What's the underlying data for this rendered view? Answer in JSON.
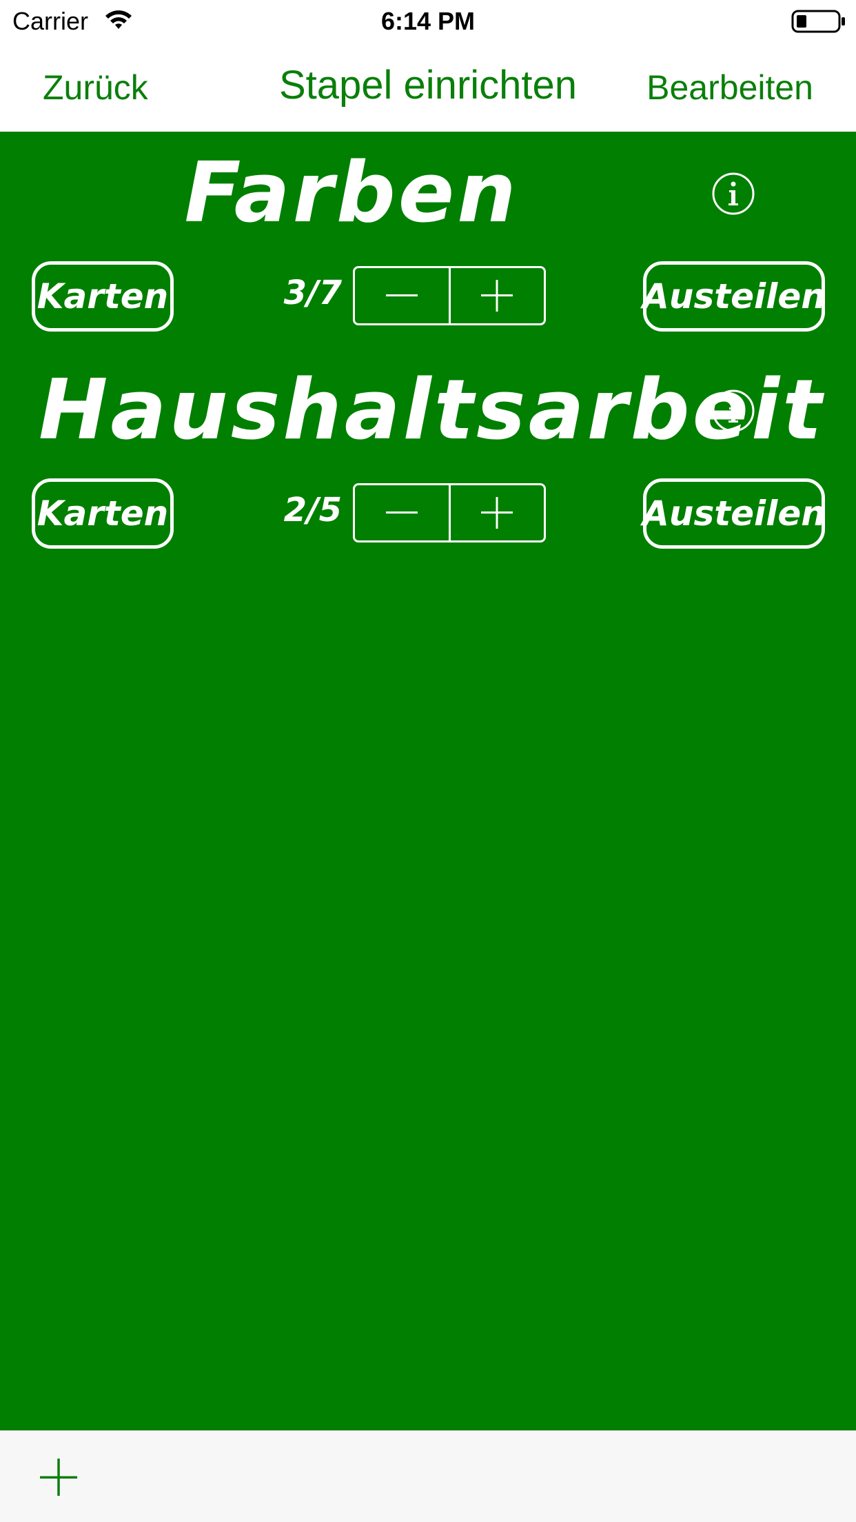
{
  "status_bar": {
    "carrier": "Carrier",
    "time": "6:14 PM",
    "wifi_icon": "wifi-icon",
    "battery_icon": "battery-icon"
  },
  "nav": {
    "back_label": "Zurück",
    "title": "Stapel einrichten",
    "edit_label": "Bearbeiten"
  },
  "colors": {
    "accent": "#0a7f0a",
    "background": "#007f00",
    "foreground": "#ffffff",
    "toolbar": "#f7f7f7"
  },
  "decks": [
    {
      "title": "Farben",
      "count": "3/7",
      "karten_label": "Karten",
      "austeilen_label": "Austeilen",
      "info_icon": "info-icon"
    },
    {
      "title": "Haushaltsarbeit",
      "count": "2/5",
      "karten_label": "Karten",
      "austeilen_label": "Austeilen",
      "info_icon": "info-icon"
    }
  ],
  "toolbar": {
    "add_icon": "plus-icon"
  }
}
